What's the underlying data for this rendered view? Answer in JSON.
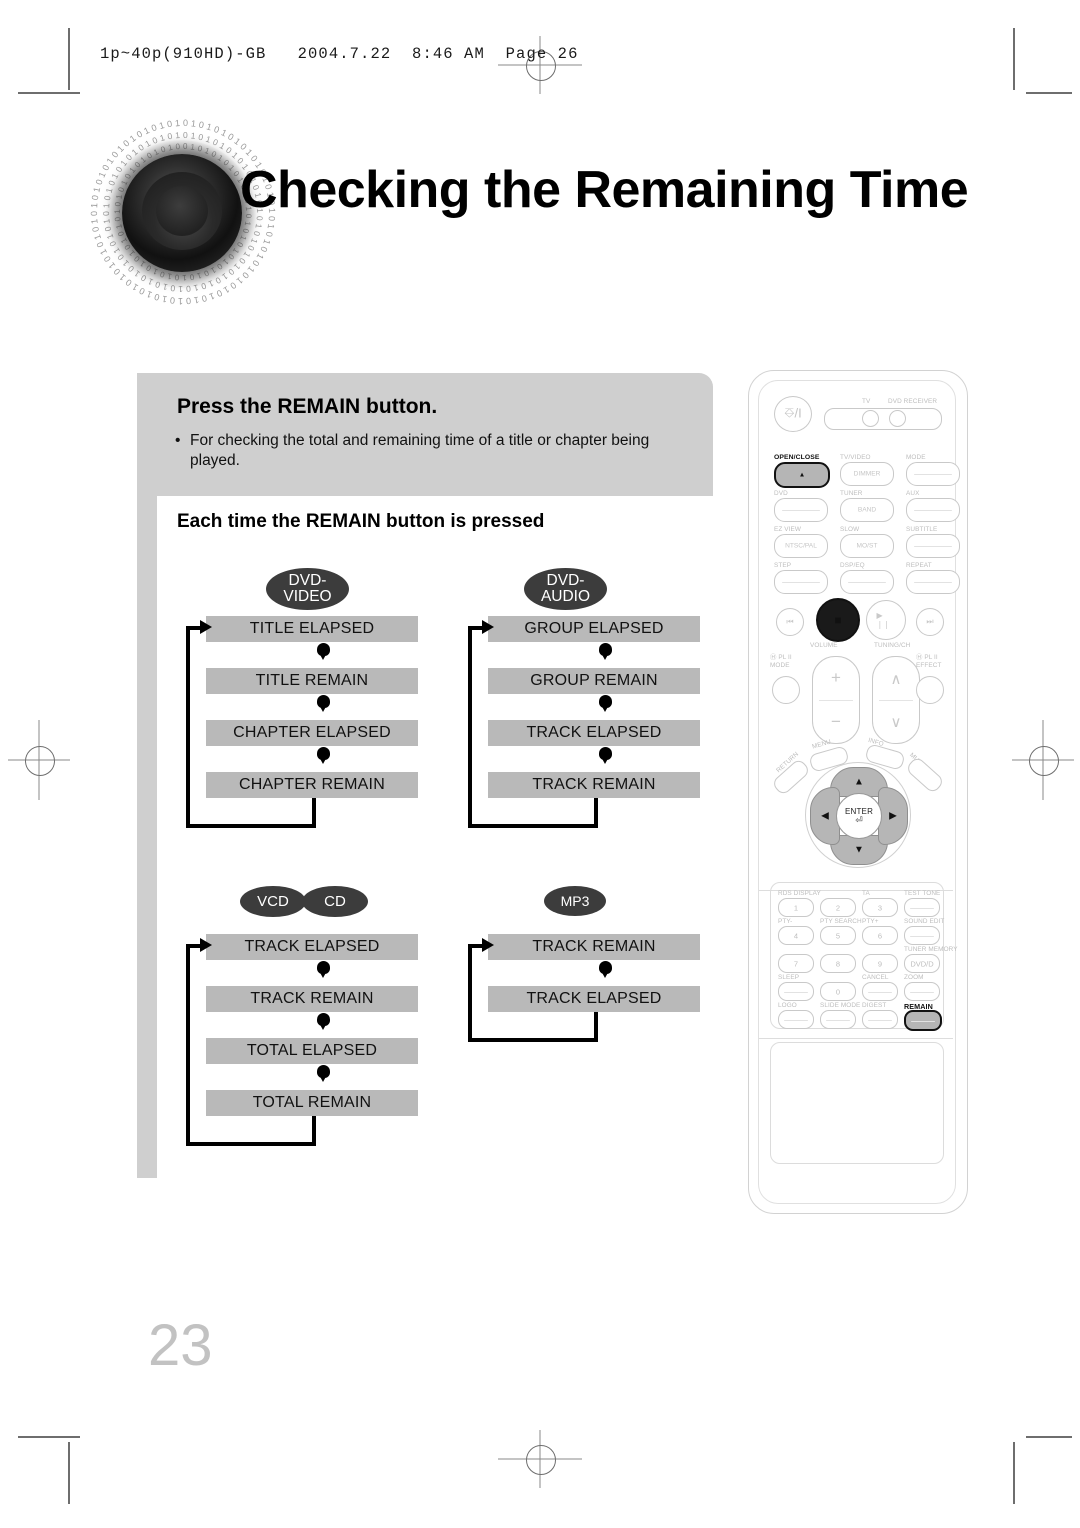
{
  "print": {
    "slug": "1p~40p(910HD)-GB   2004.7.22  8:46 AM  Page 26",
    "page_number": "23"
  },
  "header": {
    "title": "Checking the Remaining Time",
    "disc_icon": "speaker-disc-binary-icon"
  },
  "instruction": {
    "heading": "Press the REMAIN button.",
    "bullet_dot": "•",
    "bullet": "For checking the total and remaining time of a title or chapter being played."
  },
  "subheading": "Each time the REMAIN button is pressed",
  "flows": [
    {
      "id": "dvd-video",
      "badges": [
        {
          "lines": [
            "DVD-",
            "VIDEO"
          ],
          "type": "two"
        }
      ],
      "steps": [
        "TITLE ELAPSED",
        "TITLE REMAIN",
        "CHAPTER ELAPSED",
        "CHAPTER REMAIN"
      ]
    },
    {
      "id": "dvd-audio",
      "badges": [
        {
          "lines": [
            "DVD-",
            "AUDIO"
          ],
          "type": "two"
        }
      ],
      "steps": [
        "GROUP ELAPSED",
        "GROUP REMAIN",
        "TRACK ELAPSED",
        "TRACK REMAIN"
      ]
    },
    {
      "id": "vcd-cd",
      "badges": [
        {
          "lines": [
            "VCD"
          ],
          "type": "one"
        },
        {
          "lines": [
            "CD"
          ],
          "type": "one"
        }
      ],
      "steps": [
        "TRACK ELAPSED",
        "TRACK REMAIN",
        "TOTAL ELAPSED",
        "TOTAL REMAIN"
      ]
    },
    {
      "id": "mp3",
      "badges": [
        {
          "lines": [
            "MP3"
          ],
          "type": "mp3"
        }
      ],
      "steps": [
        "TRACK REMAIN",
        "TRACK ELAPSED"
      ]
    }
  ],
  "remote": {
    "name": "dvd-receiver-remote-control",
    "power_icon": "power-standby-icon",
    "selector": {
      "left_label": "TV",
      "right_label": "DVD RECEIVER"
    },
    "top_buttons": [
      {
        "top": "OPEN/CLOSE",
        "inner": "▲",
        "highlight": true
      },
      {
        "top": "TV/VIDEO",
        "inner": "DIMMER",
        "highlight": false
      },
      {
        "top": "MODE",
        "inner": "",
        "highlight": false
      },
      {
        "top": "DVD",
        "inner": "",
        "highlight": false
      },
      {
        "top": "TUNER",
        "inner": "BAND",
        "highlight": false
      },
      {
        "top": "AUX",
        "inner": "",
        "highlight": false
      },
      {
        "top": "EZ VIEW",
        "inner": "NTSC/PAL",
        "highlight": false
      },
      {
        "top": "SLOW",
        "inner": "MO/ST",
        "highlight": false
      },
      {
        "top": "SUBTITLE",
        "inner": "",
        "highlight": false
      },
      {
        "top": "STEP",
        "inner": "",
        "highlight": false
      },
      {
        "top": "DSP/EQ",
        "inner": "",
        "highlight": false
      },
      {
        "top": "REPEAT",
        "inner": "",
        "highlight": false
      }
    ],
    "transport": [
      {
        "icon": "⏮",
        "name": "skip-back-icon",
        "highlight": false
      },
      {
        "icon": "■",
        "name": "stop-icon",
        "highlight": true
      },
      {
        "icon": "▶ ❘❘",
        "name": "play-pause-icon",
        "highlight": false
      },
      {
        "icon": "⏭",
        "name": "skip-forward-icon",
        "highlight": false
      }
    ],
    "rocker_labels": {
      "volume": "VOLUME",
      "tuning": "TUNING/CH",
      "plus": "+",
      "minus": "−",
      "up": "∧",
      "down": "∨"
    },
    "side_labels": {
      "mode_top": "PL II",
      "mode_bottom": "MODE",
      "effect_top": "PL II",
      "effect_bottom": "EFFECT"
    },
    "small_buttons": {
      "menu": "MENU",
      "info": "INFO",
      "return": "RETURN",
      "mute": "MUTE"
    },
    "nav": {
      "enter": "ENTER",
      "enter_icon": "return-arrow-icon",
      "up": "▲",
      "down": "▼",
      "left": "◀",
      "right": "▶"
    },
    "keypad": [
      {
        "label": "RDS DISPLAY",
        "key": "1",
        "highlight": false
      },
      {
        "label": "",
        "key": "2",
        "highlight": false
      },
      {
        "label": "TA",
        "key": "3",
        "highlight": false
      },
      {
        "label": "TEST TONE",
        "key": "",
        "highlight": false
      },
      {
        "label": "PTY-",
        "key": "4",
        "highlight": false
      },
      {
        "label": "PTY SEARCH",
        "key": "5",
        "highlight": false
      },
      {
        "label": "PTY+",
        "key": "6",
        "highlight": false
      },
      {
        "label": "SOUND EDIT",
        "key": "",
        "highlight": false
      },
      {
        "label": "",
        "key": "7",
        "highlight": false
      },
      {
        "label": "",
        "key": "8",
        "highlight": false
      },
      {
        "label": "",
        "key": "9",
        "highlight": false
      },
      {
        "label": "TUNER MEMORY",
        "key": "DVD/D",
        "highlight": false
      },
      {
        "label": "SLEEP",
        "key": "",
        "highlight": false
      },
      {
        "label": "",
        "key": "0",
        "highlight": false
      },
      {
        "label": "CANCEL",
        "key": "",
        "highlight": false
      },
      {
        "label": "ZOOM",
        "key": "",
        "highlight": false
      },
      {
        "label": "LOGO",
        "key": "",
        "highlight": false
      },
      {
        "label": "SLIDE MODE",
        "key": "",
        "highlight": false
      },
      {
        "label": "DIGEST",
        "key": "",
        "highlight": false
      },
      {
        "label": "REMAIN",
        "key": "",
        "highlight": true
      }
    ]
  },
  "colors": {
    "panel_gray": "#cfcfcf",
    "box_gray": "#b9b9b9",
    "badge_dark": "#3c3c3c",
    "page_number_gray": "#c2c2c2"
  }
}
